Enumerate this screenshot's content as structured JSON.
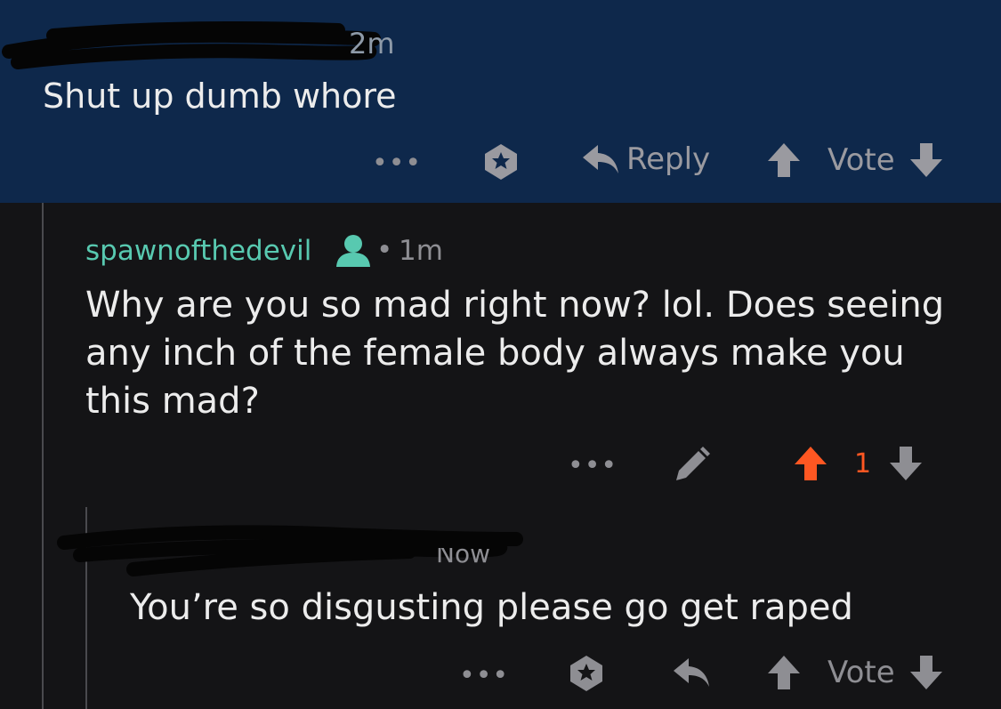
{
  "comment1": {
    "time": "2m",
    "body": "Shut up dumb whore",
    "actions": {
      "more": "•••",
      "reply_label": "Reply",
      "vote_label": "Vote"
    }
  },
  "comment2": {
    "username": "spawnofthedevil",
    "separator": "•",
    "time": "1m",
    "body_lines": [
      "Why are you so mad right now? lol. Does seeing",
      "any inch of the female body always make you",
      "this mad?"
    ],
    "actions": {
      "more": "•••",
      "score": "1"
    }
  },
  "comment3": {
    "time": "Now",
    "body": "You’re so disgusting please go get raped",
    "actions": {
      "more": "•••",
      "vote_label": "Vote"
    }
  },
  "colors": {
    "header_bg": "#0e284b",
    "page_bg": "#141416",
    "username": "#58c9b0",
    "upvote_active": "#ff5722",
    "icon_gray": "#8e8e93"
  },
  "icons": [
    "more-icon",
    "award-icon",
    "reply-icon",
    "upvote-icon",
    "downvote-icon",
    "edit-icon",
    "user-icon"
  ]
}
